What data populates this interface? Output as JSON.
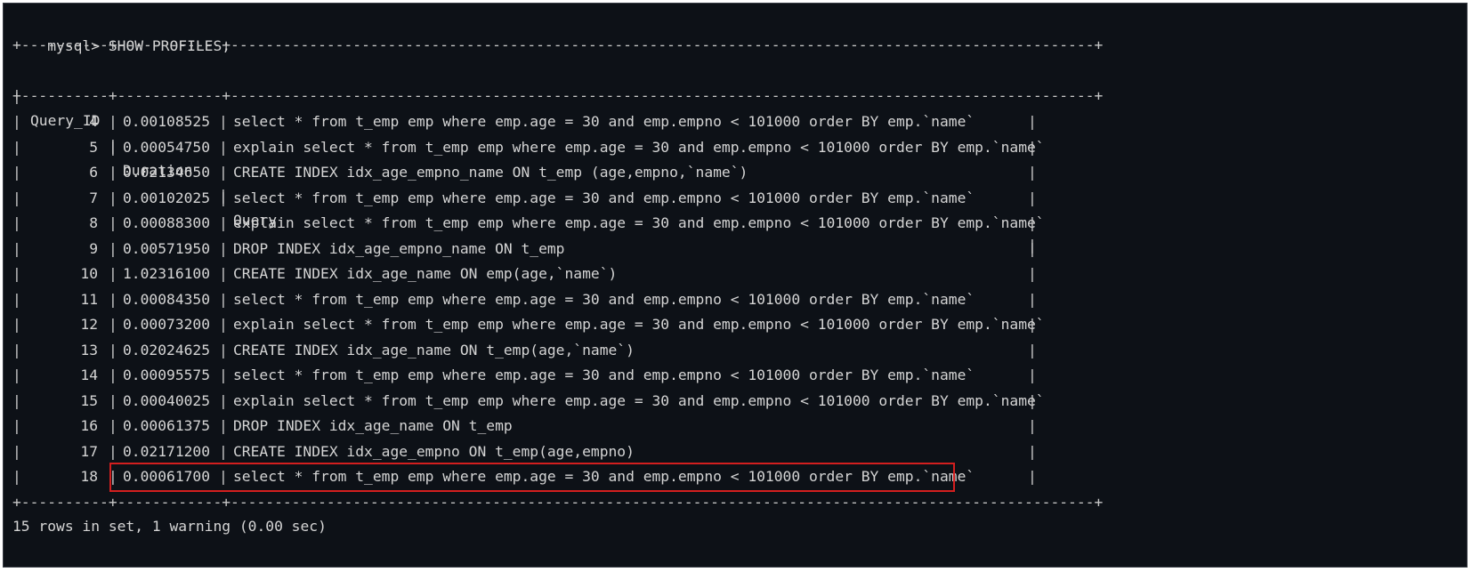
{
  "command": {
    "prompt": "mysql>",
    "text": "SHOW PROFILES;"
  },
  "table": {
    "border": "+----------+------------+---------------------------------------------------------------------------------------------------+",
    "headers": [
      "Query_ID",
      "Duration",
      "Query"
    ],
    "rows": [
      {
        "id": "4",
        "duration": "0.00108525",
        "query": "select * from t_emp emp where emp.age = 30 and emp.empno < 101000 order BY emp.`name`"
      },
      {
        "id": "5",
        "duration": "0.00054750",
        "query": "explain select * from t_emp emp where emp.age = 30 and emp.empno < 101000 order BY emp.`name`"
      },
      {
        "id": "6",
        "duration": "0.02134650",
        "query": "CREATE INDEX idx_age_empno_name ON t_emp (age,empno,`name`)"
      },
      {
        "id": "7",
        "duration": "0.00102025",
        "query": "select * from t_emp emp where emp.age = 30 and emp.empno < 101000 order BY emp.`name`"
      },
      {
        "id": "8",
        "duration": "0.00088300",
        "query": "explain select * from t_emp emp where emp.age = 30 and emp.empno < 101000 order BY emp.`name`"
      },
      {
        "id": "9",
        "duration": "0.00571950",
        "query": "DROP INDEX idx_age_empno_name ON t_emp"
      },
      {
        "id": "10",
        "duration": "1.02316100",
        "query": "CREATE INDEX idx_age_name ON emp(age,`name`)"
      },
      {
        "id": "11",
        "duration": "0.00084350",
        "query": "select * from t_emp emp where emp.age = 30 and emp.empno < 101000 order BY emp.`name`"
      },
      {
        "id": "12",
        "duration": "0.00073200",
        "query": "explain select * from t_emp emp where emp.age = 30 and emp.empno < 101000 order BY emp.`name`"
      },
      {
        "id": "13",
        "duration": "0.02024625",
        "query": "CREATE INDEX idx_age_name ON t_emp(age,`name`)"
      },
      {
        "id": "14",
        "duration": "0.00095575",
        "query": "select * from t_emp emp where emp.age = 30 and emp.empno < 101000 order BY emp.`name`"
      },
      {
        "id": "15",
        "duration": "0.00040025",
        "query": "explain select * from t_emp emp where emp.age = 30 and emp.empno < 101000 order BY emp.`name`"
      },
      {
        "id": "16",
        "duration": "0.00061375",
        "query": "DROP INDEX idx_age_name ON t_emp"
      },
      {
        "id": "17",
        "duration": "0.02171200",
        "query": "CREATE INDEX idx_age_empno ON t_emp(age,empno)"
      },
      {
        "id": "18",
        "duration": "0.00061700",
        "query": "select * from t_emp emp where emp.age = 30 and emp.empno < 101000 order BY emp.`name`"
      }
    ],
    "highlight_color": "#d31f1f"
  },
  "footer": "15 rows in set, 1 warning (0.00 sec)"
}
